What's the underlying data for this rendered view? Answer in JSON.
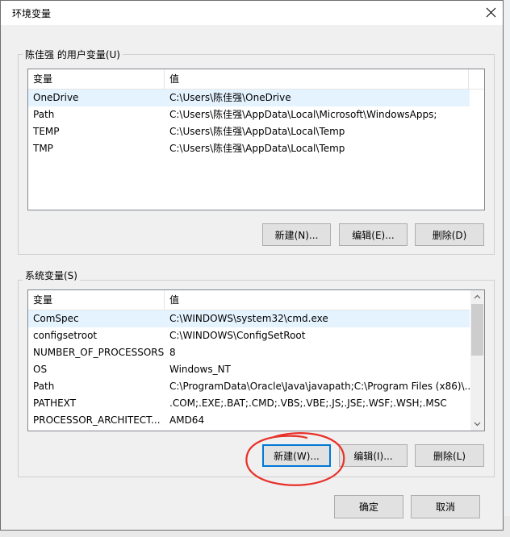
{
  "dialog": {
    "title": "环境变量",
    "ok_label": "确定",
    "cancel_label": "取消"
  },
  "user_vars": {
    "group_label": "陈佳强 的用户变量(U)",
    "columns": [
      "变量",
      "值"
    ],
    "rows": [
      {
        "name": "OneDrive",
        "value": "C:\\Users\\陈佳强\\OneDrive"
      },
      {
        "name": "Path",
        "value": "C:\\Users\\陈佳强\\AppData\\Local\\Microsoft\\WindowsApps;"
      },
      {
        "name": "TEMP",
        "value": "C:\\Users\\陈佳强\\AppData\\Local\\Temp"
      },
      {
        "name": "TMP",
        "value": "C:\\Users\\陈佳强\\AppData\\Local\\Temp"
      }
    ],
    "new_label": "新建(N)...",
    "edit_label": "编辑(E)...",
    "delete_label": "删除(D)"
  },
  "system_vars": {
    "group_label": "系统变量(S)",
    "columns": [
      "变量",
      "值"
    ],
    "rows": [
      {
        "name": "ComSpec",
        "value": "C:\\WINDOWS\\system32\\cmd.exe"
      },
      {
        "name": "configsetroot",
        "value": "C:\\WINDOWS\\ConfigSetRoot"
      },
      {
        "name": "NUMBER_OF_PROCESSORS",
        "value": "8"
      },
      {
        "name": "OS",
        "value": "Windows_NT"
      },
      {
        "name": "Path",
        "value": "C:\\ProgramData\\Oracle\\Java\\javapath;C:\\Program Files (x86)\\..."
      },
      {
        "name": "PATHEXT",
        "value": ".COM;.EXE;.BAT;.CMD;.VBS;.VBE;.JS;.JSE;.WSF;.WSH;.MSC"
      },
      {
        "name": "PROCESSOR_ARCHITECT...",
        "value": "AMD64"
      }
    ],
    "new_label": "新建(W)...",
    "edit_label": "编辑(I)...",
    "delete_label": "删除(L)"
  },
  "colors": {
    "selection": "#e5f3ff",
    "annotation": "#e8302a",
    "button_face": "#e1e1e1",
    "focus_border": "#0078d7"
  },
  "icons": {
    "close": "close-icon",
    "scroll_up": "chevron-up-icon",
    "scroll_down": "chevron-down-icon"
  }
}
